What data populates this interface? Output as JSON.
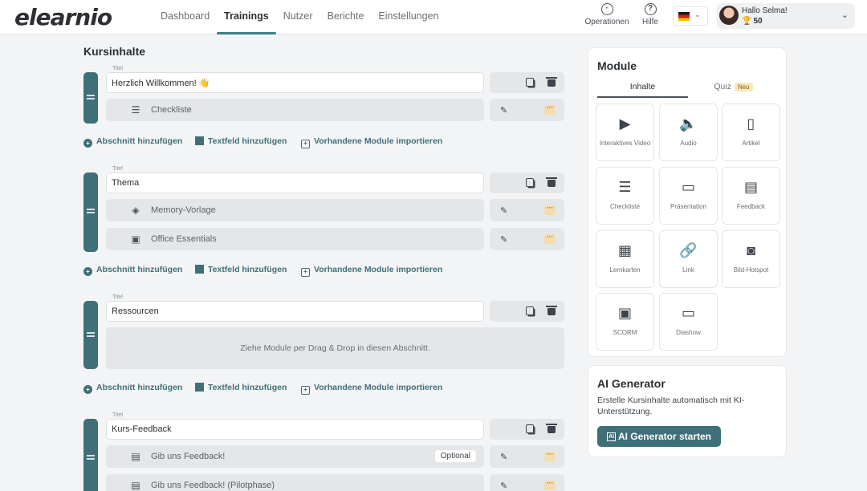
{
  "app": {
    "logo": "elearnio"
  },
  "nav": [
    "Dashboard",
    "Trainings",
    "Nutzer",
    "Berichte",
    "Einstellungen"
  ],
  "nav_active": "Trainings",
  "header": {
    "operations_label": "Operationen",
    "help_label": "Hilfe",
    "language": "de",
    "user_greeting": "Hallo Selma!",
    "user_points": "50"
  },
  "course": {
    "title": "Kursinhalte",
    "field_label": "Titel",
    "add_section": "Abschnitt hinzufügen",
    "add_textfield": "Textfeld hinzufügen",
    "import_modules": "Vorhandene Module importieren",
    "sections": [
      {
        "title": "Herzlich Willkommen! 👋",
        "modules": [
          {
            "icon": "checklist-icon",
            "name": "Checkliste"
          }
        ]
      },
      {
        "title": "Thema",
        "modules": [
          {
            "icon": "memory-icon",
            "name": "Memory-Vorlage"
          },
          {
            "icon": "image-icon",
            "name": "Office Essentials"
          }
        ]
      },
      {
        "title": "Ressourcen",
        "dropzone": "Ziehe Module per Drag & Drop in diesen Abschnitt."
      },
      {
        "title": "Kurs-Feedback",
        "modules": [
          {
            "icon": "feedback-icon",
            "name": "Gib uns Feedback!",
            "badge": "Optional"
          },
          {
            "icon": "feedback-icon",
            "name": "Gib uns Feedback! (Pilotphase)"
          }
        ]
      }
    ]
  },
  "module_panel": {
    "title": "Module",
    "tabs": [
      "Inhalte",
      "Quiz"
    ],
    "quiz_badge": "Neu",
    "tiles": [
      {
        "label": "Interaktives Video",
        "icon": "video-icon"
      },
      {
        "label": "Audio",
        "icon": "audio-icon"
      },
      {
        "label": "Artikel",
        "icon": "article-icon"
      },
      {
        "label": "Checkliste",
        "icon": "checklist-icon"
      },
      {
        "label": "Präsentation",
        "icon": "presentation-icon"
      },
      {
        "label": "Feedback",
        "icon": "feedback-icon"
      },
      {
        "label": "Lernkarten",
        "icon": "flashcards-icon"
      },
      {
        "label": "Link",
        "icon": "link-icon"
      },
      {
        "label": "Bild-Hotspot",
        "icon": "hotspot-icon"
      },
      {
        "label": "SCORM",
        "icon": "scorm-icon"
      },
      {
        "label": "Diashow",
        "icon": "slideshow-icon"
      }
    ]
  },
  "ai_generator": {
    "title": "AI Generator",
    "description": "Erstelle Kursinhalte automatisch mit KI-Unterstützung.",
    "button_icon_text": "AI",
    "button_label": "AI Generator starten"
  }
}
